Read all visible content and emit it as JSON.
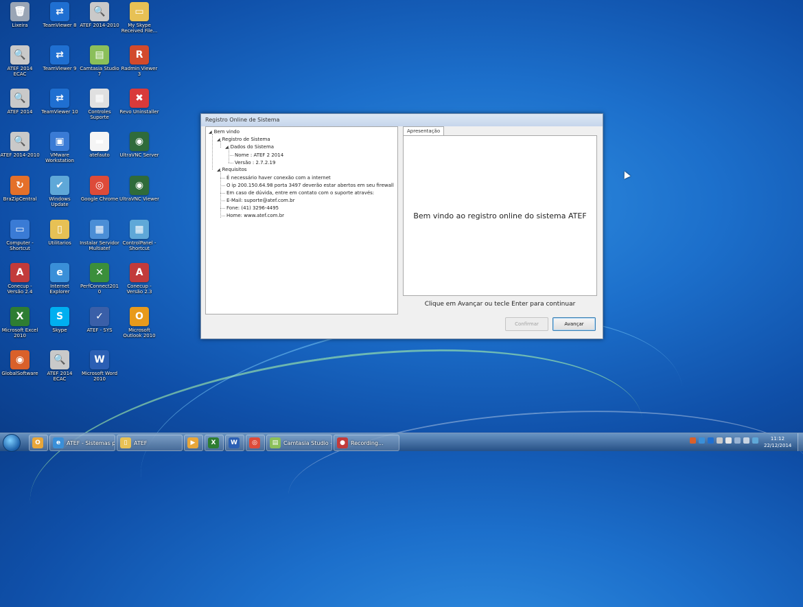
{
  "desktop_icons": [
    {
      "label": "Lixeira",
      "color": "#9aa5b5",
      "glyph": "🗑"
    },
    {
      "label": "TeamViewer 8",
      "color": "#1f6fd1",
      "glyph": "⇄"
    },
    {
      "label": "ATEF 2014-2010",
      "color": "#c9c9c9",
      "glyph": "🔍"
    },
    {
      "label": "My Skype Received File...",
      "color": "#e7c155",
      "glyph": "▭"
    },
    {
      "label": "ATEF 2014 ECAC",
      "color": "#c9c9c9",
      "glyph": "🔍"
    },
    {
      "label": "TeamViewer 9",
      "color": "#1f6fd1",
      "glyph": "⇄"
    },
    {
      "label": "Camtasia Studio 7",
      "color": "#8bbf5a",
      "glyph": "▤"
    },
    {
      "label": "Radmin Viewer 3",
      "color": "#d24a2c",
      "glyph": "R"
    },
    {
      "label": "ATEF 2014",
      "color": "#c9c9c9",
      "glyph": "🔍"
    },
    {
      "label": "TeamViewer 10",
      "color": "#1f6fd1",
      "glyph": "⇄"
    },
    {
      "label": "Controles Suporte",
      "color": "#e0e0e0",
      "glyph": "▦"
    },
    {
      "label": "Revo Uninstaller",
      "color": "#d93a3a",
      "glyph": "✖"
    },
    {
      "label": "ATEF 2014-2010",
      "color": "#c9c9c9",
      "glyph": "🔍"
    },
    {
      "label": "VMware Workstation",
      "color": "#3a7bd5",
      "glyph": "▣"
    },
    {
      "label": "atefauto",
      "color": "#f5f5f5",
      "glyph": "▬"
    },
    {
      "label": "UltraVNC Server",
      "color": "#2f6b3a",
      "glyph": "◉"
    },
    {
      "label": "BraZipCentral",
      "color": "#e4702a",
      "glyph": "↻"
    },
    {
      "label": "Windows Update",
      "color": "#5fa8d8",
      "glyph": "✔"
    },
    {
      "label": "Google Chrome",
      "color": "#dd4b39",
      "glyph": "◎"
    },
    {
      "label": "UltraVNC Viewer",
      "color": "#2f6b3a",
      "glyph": "◉"
    },
    {
      "label": "Computer - Shortcut",
      "color": "#3a7bd5",
      "glyph": "▭"
    },
    {
      "label": "Utilitarios",
      "color": "#e7c155",
      "glyph": "▯"
    },
    {
      "label": "Instalar Servidor Multiatef",
      "color": "#4b8ed6",
      "glyph": "▦"
    },
    {
      "label": "ControlPanel - Shortcut",
      "color": "#5fa8d8",
      "glyph": "▦"
    },
    {
      "label": "Conecup - Versão 2.4",
      "color": "#c23b3b",
      "glyph": "A"
    },
    {
      "label": "Internet Explorer",
      "color": "#3a8fd8",
      "glyph": "e"
    },
    {
      "label": "PerfConnect2010",
      "color": "#3b8f3b",
      "glyph": "✕"
    },
    {
      "label": "Conecup - Versão 2.3",
      "color": "#c23b3b",
      "glyph": "A"
    },
    {
      "label": "Microsoft Excel 2010",
      "color": "#2e7d32",
      "glyph": "X"
    },
    {
      "label": "Skype",
      "color": "#00aff0",
      "glyph": "S"
    },
    {
      "label": "ATEF - SYS",
      "color": "#3a5fa8",
      "glyph": "✓"
    },
    {
      "label": "Microsoft Outlook 2010",
      "color": "#e89a1c",
      "glyph": "O"
    },
    {
      "label": "GlobalSoftware",
      "color": "#d9602a",
      "glyph": "◉"
    },
    {
      "label": "ATEF 2014 ECAC",
      "color": "#c9c9c9",
      "glyph": "🔍"
    },
    {
      "label": "Microsoft Word 2010",
      "color": "#2b5fb4",
      "glyph": "W"
    }
  ],
  "dialog": {
    "title": "Registro Online de Sistema",
    "tree": {
      "root": "Bem vindo",
      "registro": "Registro de Sistema",
      "dados": "Dados do Sistema",
      "nome": "Nome : ATEF 2 2014",
      "versao": "Versão : 2.7.2.19",
      "requisitos": "Requisitos",
      "req1": "É necessário haver conexão com a internet",
      "req2": "O ip 200.150.64.98 porta 3497 deverão estar abertos em seu firewall",
      "req3": "Em caso de dúvida, entre em contato com o suporte através:",
      "req4": "E-Mail: suporte@atef.com.br",
      "req5": "Fone: (41) 3296-4495",
      "req6": "Home: www.atef.com.br"
    },
    "tab_label": "Apresentação",
    "welcome_text": "Bem vindo ao registro online do sistema ATEF",
    "hint_text": "Clique em Avançar ou tecle Enter para continuar",
    "confirm_label": "Confirmar",
    "next_label": "Avançar"
  },
  "taskbar": {
    "items": [
      {
        "label": "",
        "color": "#e8a63a",
        "glyph": "O",
        "width": 26
      },
      {
        "label": "ATEF - Sistemas p...",
        "color": "#3a8fd8",
        "glyph": "e",
        "width": 94
      },
      {
        "label": "ATEF",
        "color": "#e7c155",
        "glyph": "▯",
        "width": 94
      },
      {
        "label": "",
        "color": "#e8a63a",
        "glyph": "▶",
        "width": 26
      },
      {
        "label": "",
        "color": "#2e7d32",
        "glyph": "X",
        "width": 26
      },
      {
        "label": "",
        "color": "#2b5fb4",
        "glyph": "W",
        "width": 26
      },
      {
        "label": "",
        "color": "#dd4b39",
        "glyph": "◎",
        "width": 26
      },
      {
        "label": "Camtasia Studio -...",
        "color": "#8bbf5a",
        "glyph": "▤",
        "width": 94
      },
      {
        "label": "Recording...",
        "color": "#c23b3b",
        "glyph": "●",
        "width": 94
      }
    ],
    "clock_time": "11:12",
    "clock_date": "22/12/2014"
  }
}
